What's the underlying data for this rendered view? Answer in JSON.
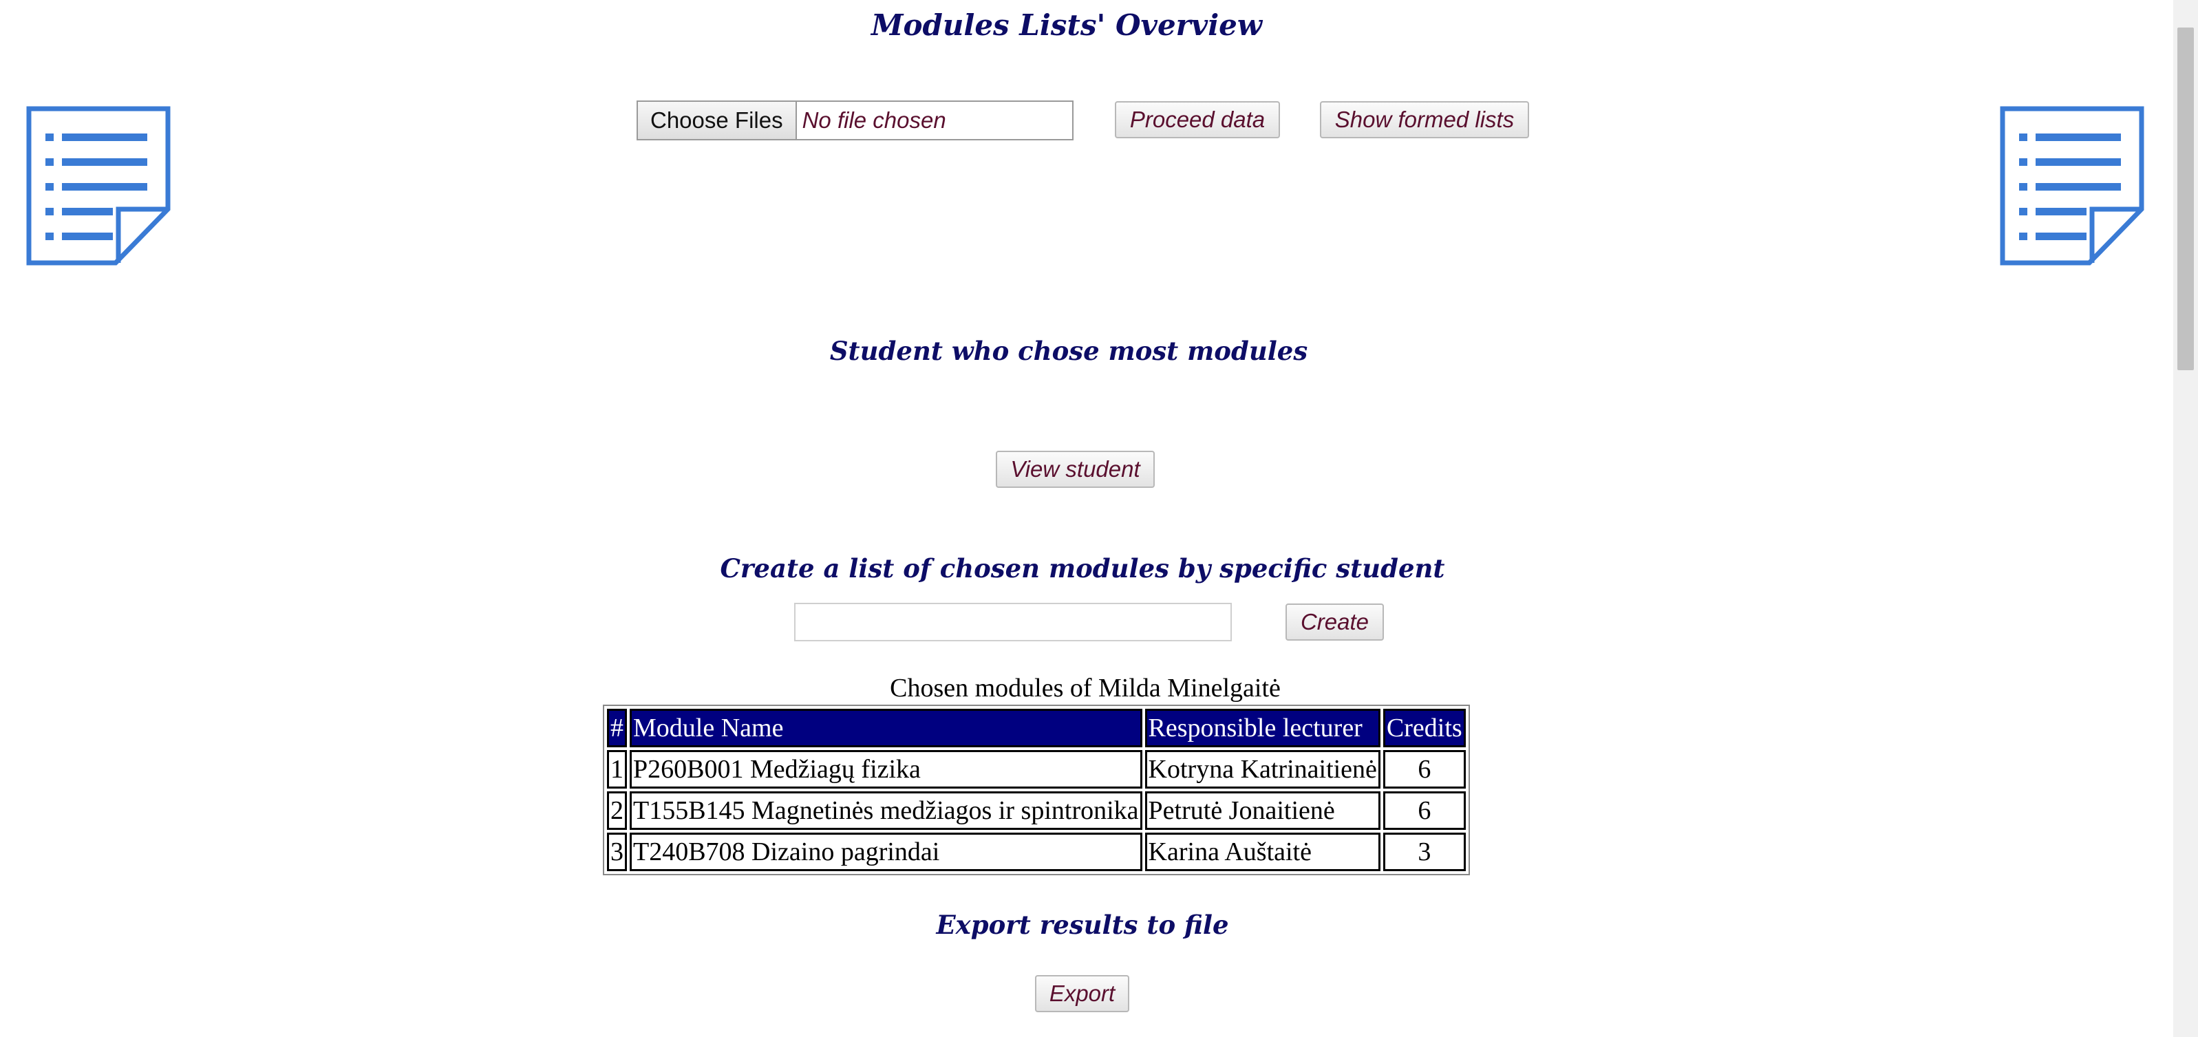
{
  "page": {
    "title": "Modules Lists' Overview"
  },
  "upload": {
    "choose_files_label": "Choose Files",
    "file_status": "No file chosen",
    "proceed_label": "Proceed data",
    "show_lists_label": "Show formed lists"
  },
  "most_modules": {
    "heading": "Student who chose most modules",
    "view_label": "View student"
  },
  "create_list": {
    "heading": "Create a list of chosen modules by specific student",
    "input_value": "",
    "create_label": "Create"
  },
  "results": {
    "caption": "Chosen modules of Milda Minelgaitė",
    "columns": [
      "#",
      "Module Name",
      "Responsible lecturer",
      "Credits"
    ],
    "rows": [
      {
        "num": "1",
        "module": "P260B001 Medžiagų fizika",
        "lecturer": "Kotryna Katrinaitienė",
        "credits": "6"
      },
      {
        "num": "2",
        "module": "T155B145 Magnetinės medžiagos ir spintronika",
        "lecturer": "Petrutė Jonaitienė",
        "credits": "6"
      },
      {
        "num": "3",
        "module": "T240B708 Dizaino pagrindai",
        "lecturer": "Karina Auštaitė",
        "credits": "3"
      }
    ]
  },
  "export": {
    "heading": "Export results to file",
    "export_label": "Export"
  },
  "icons": {
    "left": "document-list-icon",
    "right": "document-list-icon",
    "icon_color": "#3a7bd5"
  },
  "colors": {
    "heading": "#0d0d66",
    "button_text": "#5a0f2e",
    "table_header_bg": "#000080"
  }
}
